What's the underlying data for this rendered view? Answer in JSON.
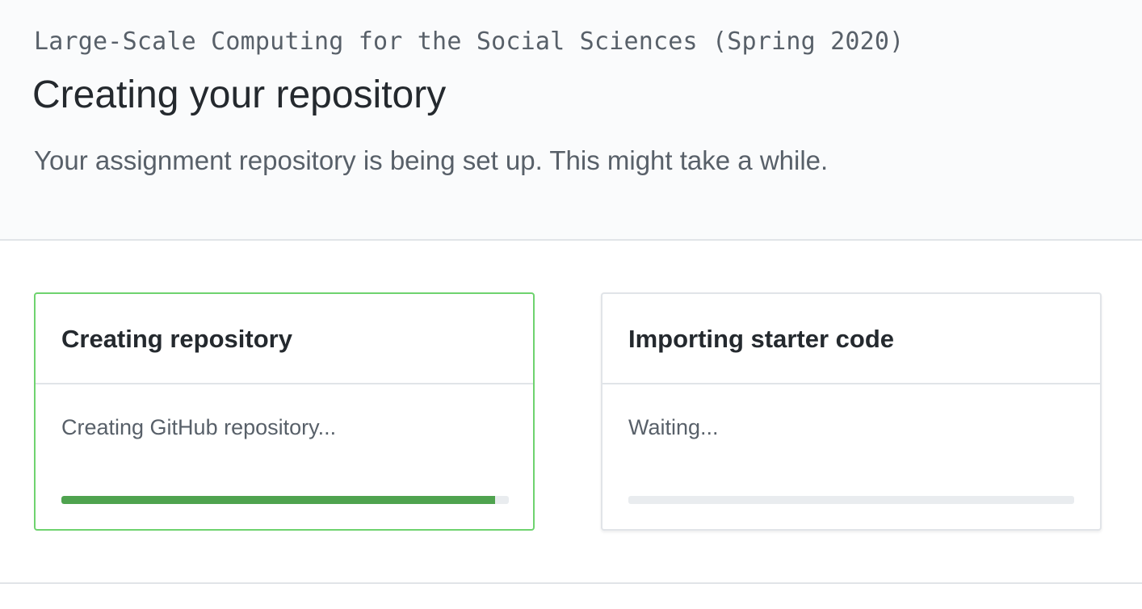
{
  "header": {
    "course_title": "Large-Scale Computing for the Social Sciences (Spring 2020)",
    "page_title": "Creating your repository",
    "subtitle": "Your assignment repository is being set up. This might take a while."
  },
  "steps": [
    {
      "title": "Creating repository",
      "status": "Creating GitHub repository...",
      "progress_percent": 97,
      "state": "active"
    },
    {
      "title": "Importing starter code",
      "status": "Waiting...",
      "progress_percent": 0,
      "state": "waiting"
    }
  ],
  "colors": {
    "active_border": "#6fd36f",
    "progress_fill": "#4fa34f",
    "progress_track": "#e9ecef",
    "header_bg": "#fafbfc"
  }
}
